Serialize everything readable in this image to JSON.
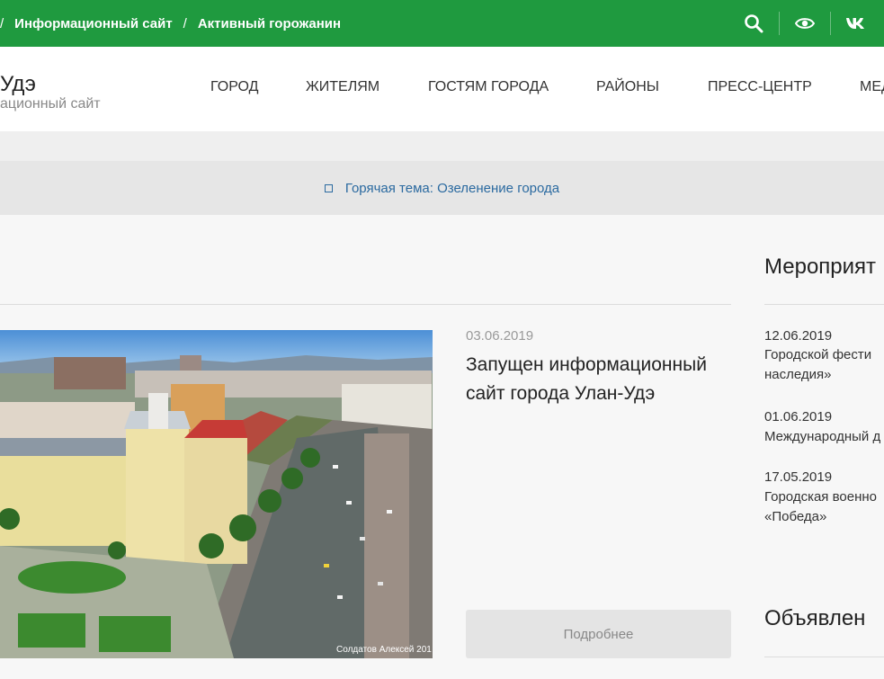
{
  "topbar": {
    "crumbs": [
      "Информационный сайт",
      "Активный горожанин"
    ],
    "sep": "/",
    "icons": [
      "search-icon",
      "eye-icon",
      "vk-icon"
    ]
  },
  "header": {
    "logo_title": "Удэ",
    "logo_sub": "ационный сайт",
    "nav": [
      "ГОРОД",
      "ЖИТЕЛЯМ",
      "ГОСТЯМ ГОРОДА",
      "РАЙОНЫ",
      "ПРЕСС-ЦЕНТР",
      "МЕД"
    ]
  },
  "hot_topic": {
    "label": "Горячая тема: Озеленение города"
  },
  "news": {
    "date": "03.06.2019",
    "title": "Запущен информационный сайт города Улан-Удэ",
    "more": "Подробнее",
    "photo_caption": "Солдатов Алексей 201"
  },
  "events": {
    "heading": "Мероприят",
    "items": [
      {
        "date": "12.06.2019",
        "lines": [
          "Городской фести",
          "наследия»"
        ]
      },
      {
        "date": "01.06.2019",
        "lines": [
          "Международный д"
        ]
      },
      {
        "date": "17.05.2019",
        "lines": [
          "Городская военно",
          "«Победа»"
        ]
      }
    ]
  },
  "announcements": {
    "heading": "Объявлен"
  },
  "colors": {
    "brand_green": "#1f9a3f",
    "link_blue": "#2b6aa0"
  }
}
